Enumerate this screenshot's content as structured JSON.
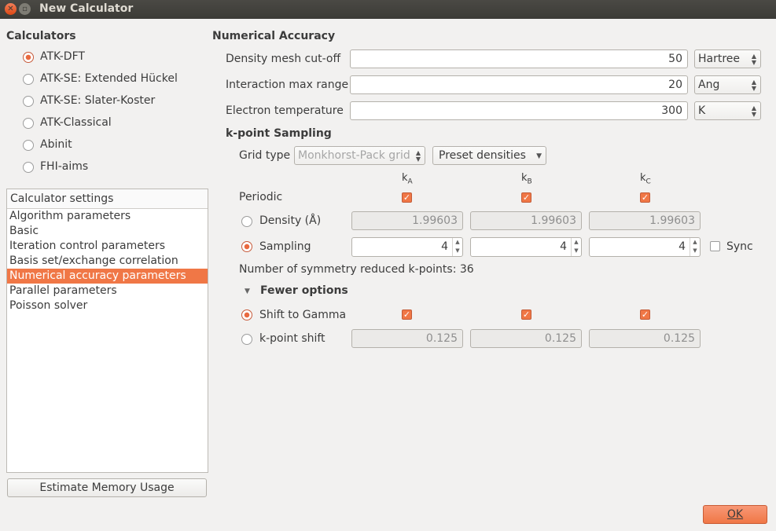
{
  "window": {
    "title": "New Calculator"
  },
  "calculators": {
    "title": "Calculators",
    "options": [
      {
        "label": "ATK-DFT",
        "selected": true
      },
      {
        "label": "ATK-SE: Extended Hückel",
        "selected": false
      },
      {
        "label": "ATK-SE: Slater-Koster",
        "selected": false
      },
      {
        "label": "ATK-Classical",
        "selected": false
      },
      {
        "label": "Abinit",
        "selected": false
      },
      {
        "label": "FHI-aims",
        "selected": false
      }
    ]
  },
  "settings": {
    "header": "Calculator settings",
    "items": [
      "Algorithm parameters",
      "Basic",
      "Iteration control parameters",
      "Basis set/exchange correlation",
      "Numerical accuracy parameters",
      "Parallel parameters",
      "Poisson solver"
    ],
    "selected_index": 4
  },
  "estimate_button": "Estimate Memory Usage",
  "ok_button": "OK",
  "accuracy": {
    "title": "Numerical Accuracy",
    "rows": [
      {
        "label": "Density mesh cut-off",
        "value": "50",
        "unit": "Hartree"
      },
      {
        "label": "Interaction max range",
        "value": "20",
        "unit": "Ang"
      },
      {
        "label": "Electron temperature",
        "value": "300",
        "unit": "K"
      }
    ]
  },
  "kpoint": {
    "title": "k-point Sampling",
    "grid_type_label": "Grid type",
    "grid_type_value": "Monkhorst-Pack grid",
    "preset_label": "Preset densities",
    "axis_base": "k",
    "axes": [
      "A",
      "B",
      "C"
    ],
    "periodic_label": "Periodic",
    "density_label": "Density (Å)",
    "density_values": [
      "1.99603",
      "1.99603",
      "1.99603"
    ],
    "sampling_label": "Sampling",
    "sampling_values": [
      "4",
      "4",
      "4"
    ],
    "sync_label": "Sync",
    "symmetry_text": "Number of symmetry reduced k-points: 36",
    "fewer_options_label": "Fewer options",
    "shift_gamma_label": "Shift to Gamma",
    "kpoint_shift_label": "k-point shift",
    "shift_values": [
      "0.125",
      "0.125",
      "0.125"
    ]
  }
}
